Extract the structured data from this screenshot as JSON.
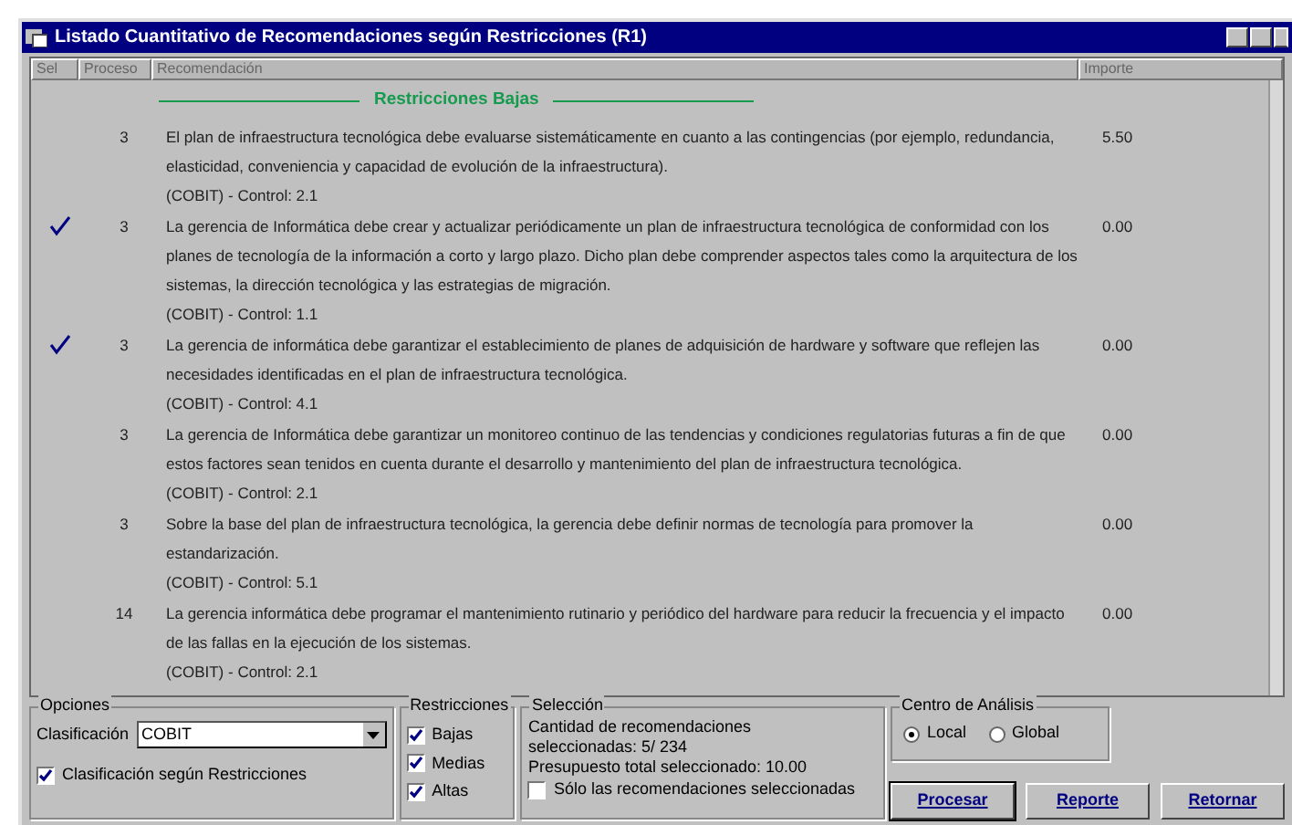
{
  "window": {
    "title": "Listado Cuantitativo de Recomendaciones según Restricciones (R1)"
  },
  "columns": [
    "Sel",
    "Proceso",
    "Recomendación",
    "Importe"
  ],
  "group_heading": "Restricciones Bajas",
  "rows": [
    {
      "selected": false,
      "process": "3",
      "text": "El plan de infraestructura tecnológica debe evaluarse sistemáticamente en cuanto a las contingencias (por ejemplo, redundancia, elasticidad, conveniencia y capacidad de evolución de la infraestructura).",
      "control": "(COBIT) - Control: 2.1",
      "amount": "5.50"
    },
    {
      "selected": true,
      "process": "3",
      "text": "La gerencia de Informática debe crear y actualizar periódicamente un plan de infraestructura tecnológica de conformidad con los planes de tecnología de la información a corto y largo plazo. Dicho plan debe comprender aspectos tales como la arquitectura de los sistemas, la dirección tecnológica y las estrategias de migración.",
      "control": "(COBIT) - Control: 1.1",
      "amount": "0.00"
    },
    {
      "selected": true,
      "process": "3",
      "text": "La gerencia de informática debe garantizar el establecimiento de planes de adquisición de hardware y software que reflejen las necesidades identificadas en el plan de infraestructura tecnológica.",
      "control": "(COBIT) - Control: 4.1",
      "amount": "0.00"
    },
    {
      "selected": false,
      "process": "3",
      "text": "La gerencia de Informática debe garantizar un monitoreo continuo de las tendencias y condiciones regulatorias futuras a fin de que estos factores sean tenidos en cuenta durante el desarrollo y mantenimiento del plan de infraestructura tecnológica.",
      "control": "(COBIT) - Control: 2.1",
      "amount": "0.00"
    },
    {
      "selected": false,
      "process": "3",
      "text": "Sobre la base del plan de infraestructura tecnológica, la gerencia debe definir normas de tecnología para promover la estandarización.",
      "control": "(COBIT) - Control: 5.1",
      "amount": "0.00"
    },
    {
      "selected": false,
      "process": "14",
      "text": "La gerencia informática debe programar el mantenimiento rutinario y periódico del hardware para reducir la frecuencia y el impacto de las fallas en la ejecución de los sistemas.",
      "control": "(COBIT) - Control: 2.1",
      "amount": "0.00"
    }
  ],
  "options": {
    "title": "Opciones",
    "classification_label": "Clasificación",
    "classification_value": "COBIT",
    "by_restrictions": {
      "label": "Clasificación según Restricciones",
      "checked": true
    }
  },
  "restrictions": {
    "title": "Restricciones",
    "items": [
      {
        "label": "Bajas",
        "checked": true
      },
      {
        "label": "Medias",
        "checked": true
      },
      {
        "label": "Altas",
        "checked": true
      }
    ]
  },
  "selection": {
    "title": "Selección",
    "lines": [
      "Cantidad de recomendaciones",
      "seleccionadas:  5/ 234",
      "Presupuesto total seleccionado: 10.00"
    ],
    "only_selected": {
      "label": "Sólo las recomendaciones seleccionadas",
      "checked": false
    }
  },
  "analysis_center": {
    "title": "Centro de Análisis",
    "options": [
      {
        "label": "Local",
        "selected": true
      },
      {
        "label": "Global",
        "selected": false
      }
    ]
  },
  "buttons": [
    "Procesar",
    "Reporte",
    "Retornar"
  ]
}
